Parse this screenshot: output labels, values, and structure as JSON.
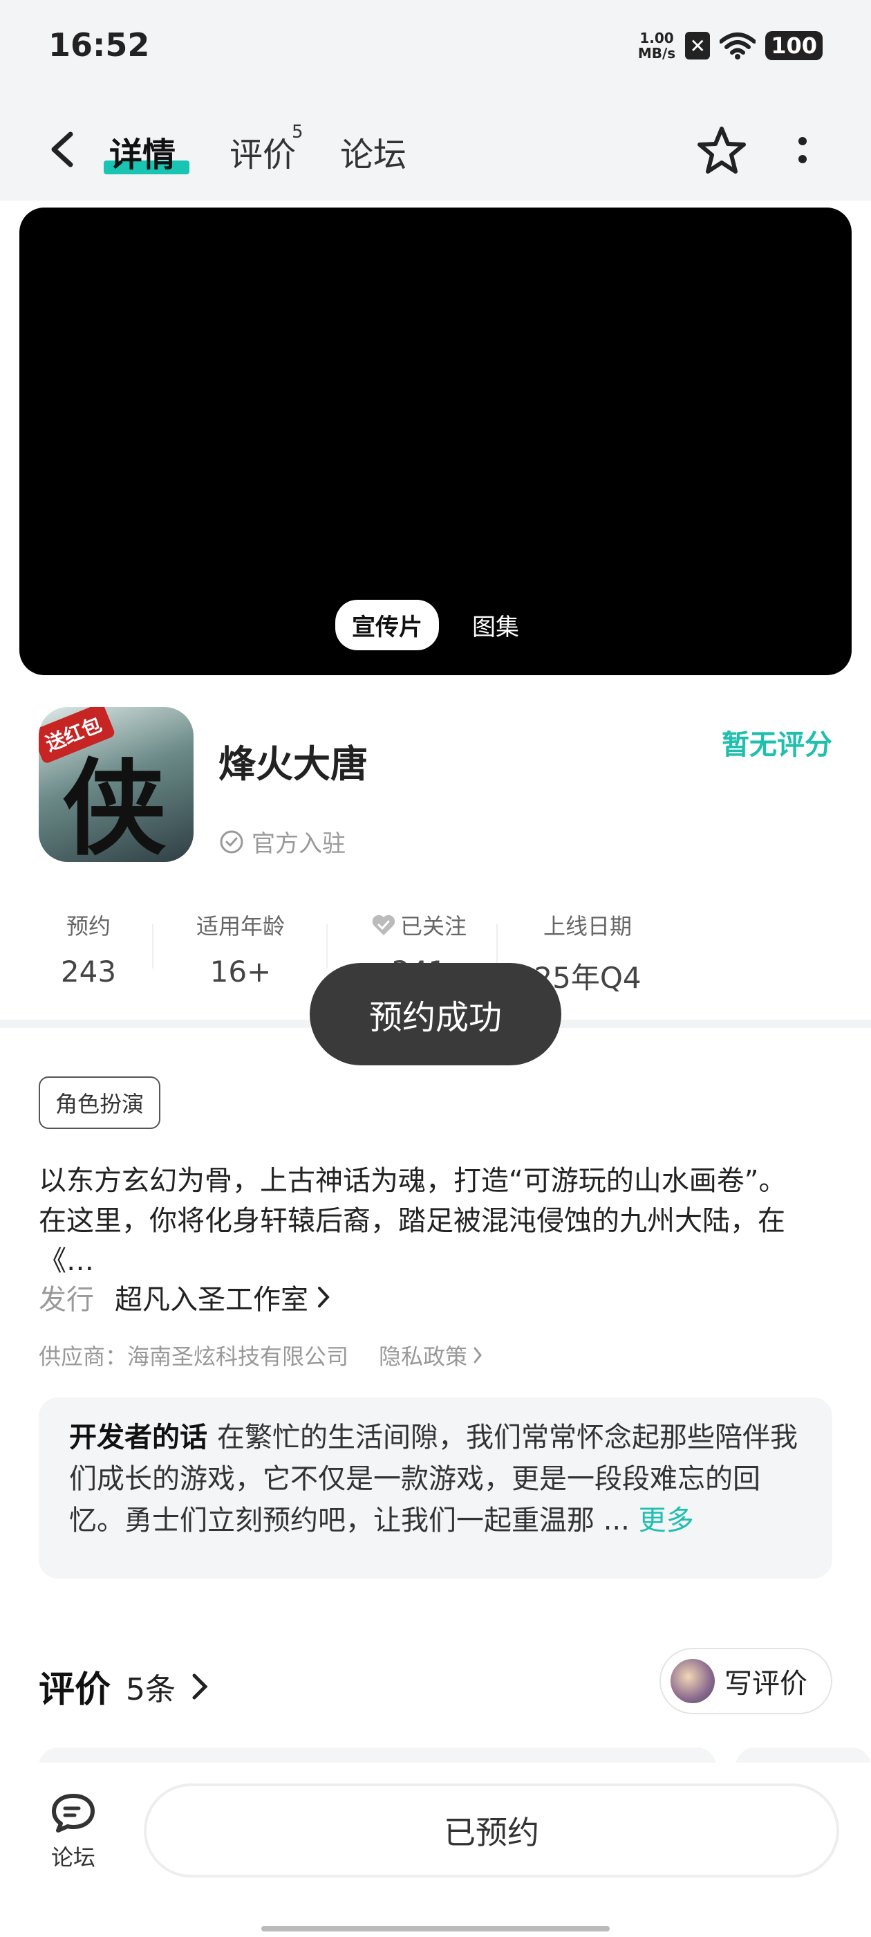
{
  "status_bar": {
    "time": "16:52",
    "net_speed_value": "1.00",
    "net_speed_unit": "MB/s",
    "battery": "100"
  },
  "nav": {
    "tabs": [
      {
        "label": "详情"
      },
      {
        "label": "评价"
      },
      {
        "label": "论坛"
      }
    ],
    "review_badge": "5"
  },
  "video": {
    "pills": [
      {
        "label": "宣传片"
      },
      {
        "label": "图集"
      }
    ]
  },
  "app": {
    "icon_badge": "送红包",
    "icon_char": "侠",
    "name": "烽火大唐",
    "official": "官方入驻",
    "rating": "暂无评分"
  },
  "stats": [
    {
      "label": "预约",
      "value": "243"
    },
    {
      "label": "适用年龄",
      "value": "16+"
    },
    {
      "label": "已关注",
      "value": "341"
    },
    {
      "label": "上线日期",
      "value": "25年Q4"
    }
  ],
  "toast": "预约成功",
  "tag": "角色扮演",
  "description": {
    "line1": "以东方玄幻为骨，上古神话为魂，打造“可游玩的山水画卷”。",
    "line2": "在这里，你将化身轩辕后裔，踏足被混沌侵蚀的九州大陆，在《…"
  },
  "publisher": {
    "label": "发行",
    "value": "超凡入圣工作室"
  },
  "supplier": {
    "text": "供应商：海南圣炫科技有限公司",
    "privacy": "隐私政策"
  },
  "developer": {
    "title": "开发者的话",
    "text": "在繁忙的生活间隙，我们常常怀念起那些陪伴我们成长的游戏，它不仅是一款游戏，更是一段段难忘的回忆。勇士们立刻预约吧，让我们一起重温那 ...",
    "more": "更多"
  },
  "reviews": {
    "title": "评价",
    "count": "5条",
    "write_label": "写评价"
  },
  "bottom": {
    "forum_label": "论坛",
    "reserved_label": "已预约"
  },
  "colors": {
    "accent": "#19c4b3",
    "toast_bg": "#3a3a3a",
    "video_bg": "#000000"
  }
}
